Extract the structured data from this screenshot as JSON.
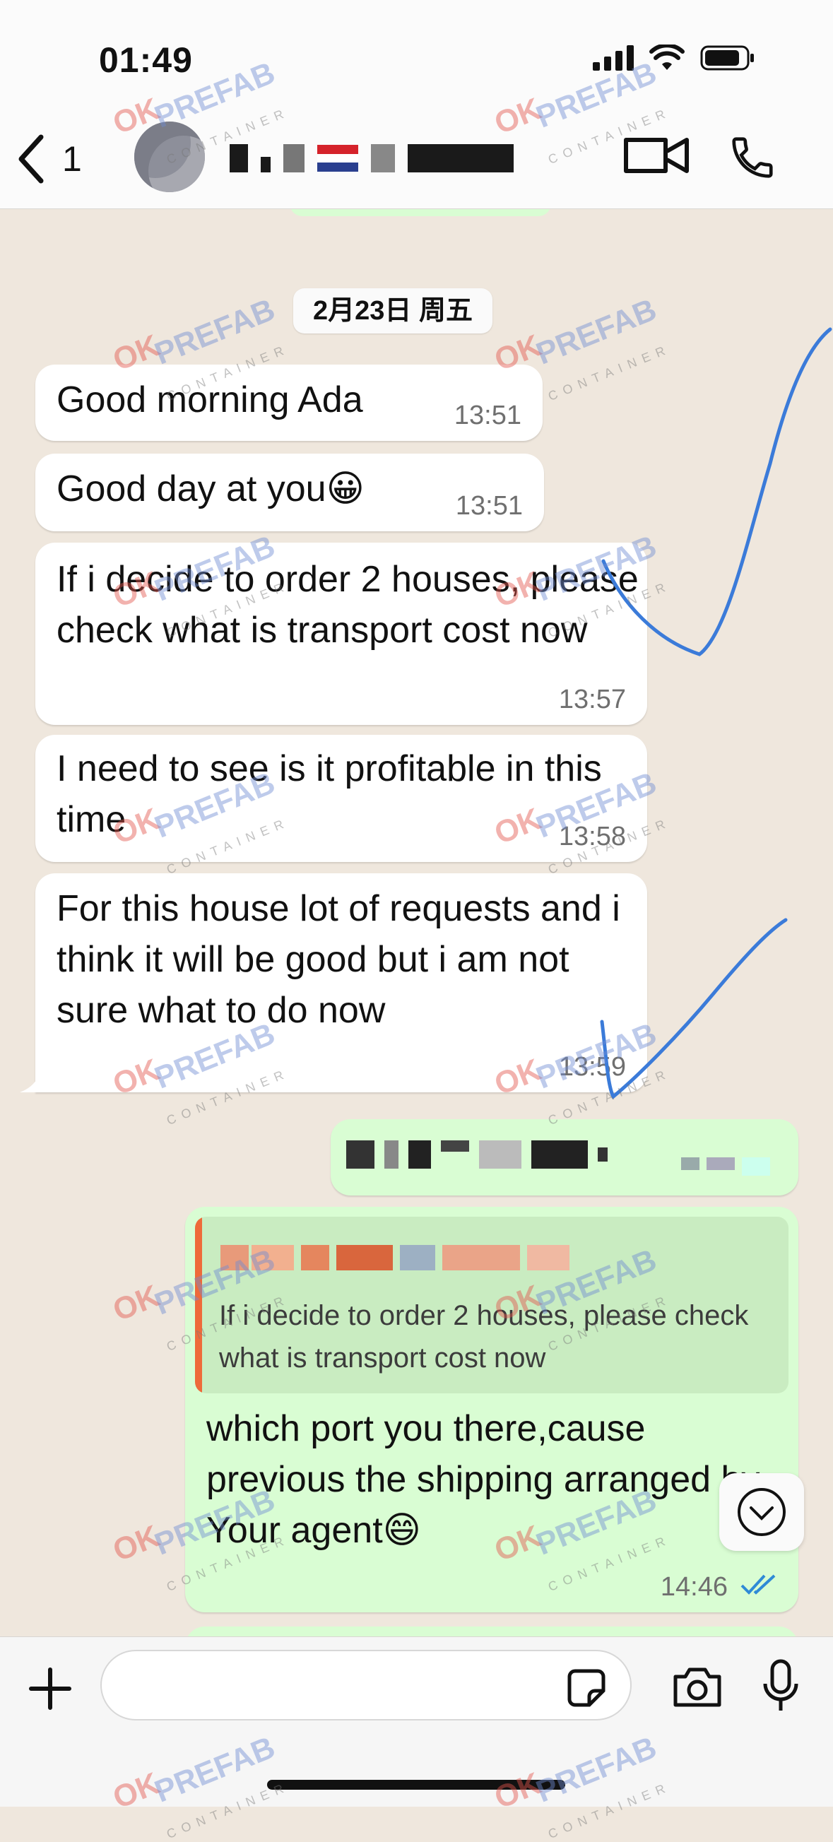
{
  "status_bar": {
    "time": "01:49"
  },
  "header": {
    "back_count": "1",
    "icons": {
      "back": "chevron-left-icon",
      "video": "video-call-icon",
      "call": "phone-icon"
    }
  },
  "chat": {
    "date_chip": "2月23日 周五",
    "messages": [
      {
        "dir": "in",
        "text": "Good morning Ada",
        "time": "13:51"
      },
      {
        "dir": "in",
        "text": "Good day at you😀",
        "time": "13:51"
      },
      {
        "dir": "in",
        "text": "If i decide to order 2 houses, please check what is transport cost now",
        "time": "13:57"
      },
      {
        "dir": "in",
        "text": "I need to see is it profitable in this time",
        "time": "13:58"
      },
      {
        "dir": "in",
        "text": "For this house lot of requests and i think it will be good but i am not sure what to do now",
        "time": "13:59"
      },
      {
        "dir": "out",
        "text": "",
        "time": ""
      },
      {
        "dir": "out",
        "quoted_text": "If i decide to order 2 houses, please check what is transport cost now",
        "text": "which port you there,cause previous the shipping arranged by Your agent😄",
        "time": "14:46",
        "status": "read"
      }
    ]
  },
  "watermark": {
    "brand_ok": "OK",
    "brand_name": "PREFAB",
    "brand_sub": "CONTAINER"
  },
  "composer": {
    "placeholder": "",
    "icons": {
      "attach": "plus-icon",
      "sticker": "sticker-icon",
      "camera": "camera-icon",
      "mic": "microphone-icon",
      "scroll": "scroll-down-icon"
    }
  },
  "colors": {
    "chat_bg": "#efe7dd",
    "incoming": "#ffffff",
    "outgoing": "#d9fdd3",
    "read_ticks": "#2f8ad6",
    "quote_bar": "#ee6a3a",
    "annotation": "#3b7bd9"
  }
}
